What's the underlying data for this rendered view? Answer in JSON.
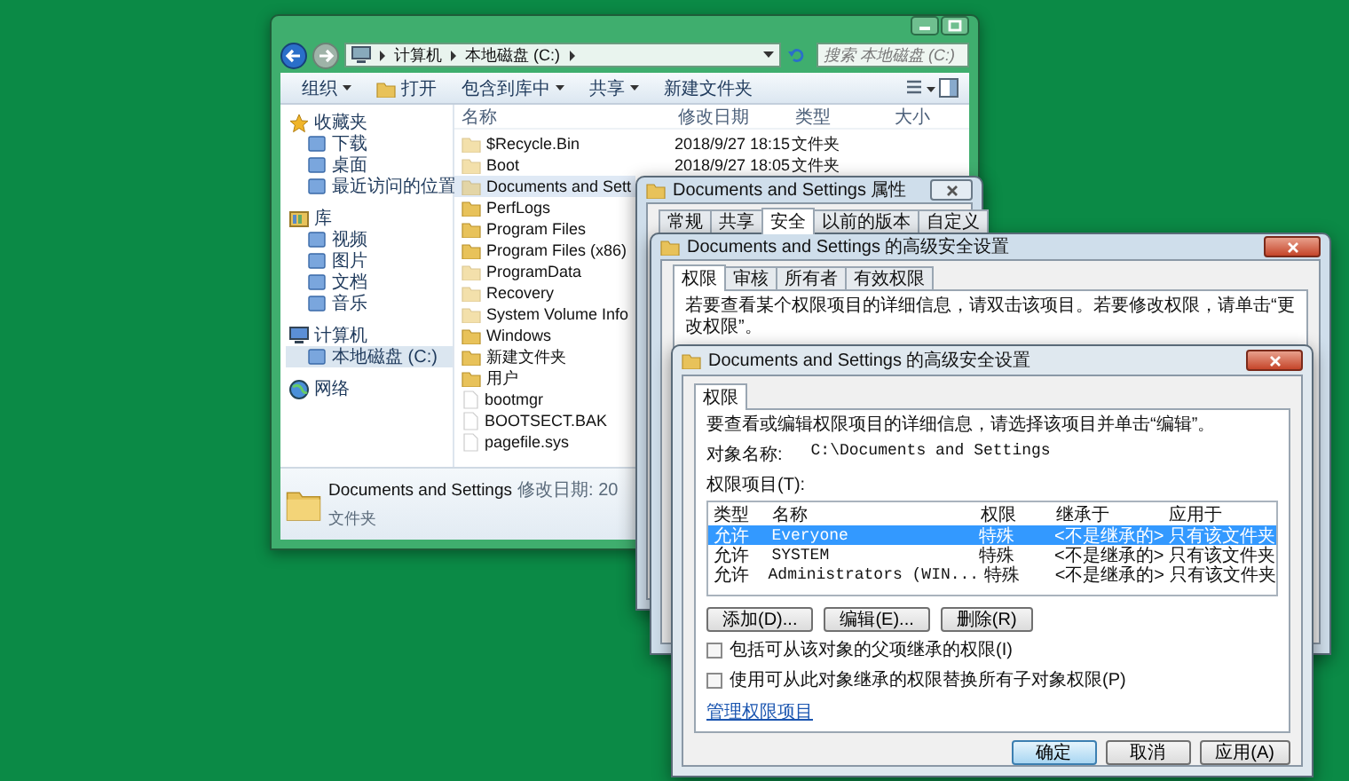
{
  "explorer": {
    "address": {
      "segments": [
        "计算机",
        "本地磁盘 (C:)"
      ]
    },
    "search": {
      "placeholder": "搜索 本地磁盘 (C:)"
    },
    "toolbar": [
      {
        "label": "组织",
        "dropdown": true,
        "has_icon": false
      },
      {
        "label": "打开",
        "dropdown": false,
        "has_icon": true
      },
      {
        "label": "包含到库中",
        "dropdown": true,
        "has_icon": false
      },
      {
        "label": "共享",
        "dropdown": true,
        "has_icon": false
      },
      {
        "label": "新建文件夹",
        "dropdown": false,
        "has_icon": false
      }
    ],
    "sidebar": [
      {
        "label": "收藏夹",
        "kind": "favorites",
        "selected": false,
        "children": [
          {
            "label": "下载",
            "selected": false
          },
          {
            "label": "桌面",
            "selected": false
          },
          {
            "label": "最近访问的位置",
            "selected": false
          }
        ]
      },
      {
        "label": "库",
        "kind": "libraries",
        "selected": false,
        "children": [
          {
            "label": "视频",
            "selected": false
          },
          {
            "label": "图片",
            "selected": false
          },
          {
            "label": "文档",
            "selected": false
          },
          {
            "label": "音乐",
            "selected": false
          }
        ]
      },
      {
        "label": "计算机",
        "kind": "computer",
        "selected": false,
        "children": [
          {
            "label": "本地磁盘 (C:)",
            "selected": true
          }
        ]
      },
      {
        "label": "网络",
        "kind": "network",
        "selected": false
      }
    ],
    "columns": [
      "名称",
      "修改日期",
      "类型",
      "大小"
    ],
    "rows": [
      {
        "name": "$Recycle.Bin",
        "date": "2018/9/27 18:15",
        "type": "文件夹",
        "kind": "folder",
        "hidden": true,
        "selected": false
      },
      {
        "name": "Boot",
        "date": "2018/9/27 18:05",
        "type": "文件夹",
        "kind": "folder",
        "hidden": true,
        "selected": false
      },
      {
        "name": "Documents and Sett",
        "kind": "folder",
        "hidden": true,
        "selected": true
      },
      {
        "name": "PerfLogs",
        "kind": "folder",
        "hidden": false,
        "selected": false
      },
      {
        "name": "Program Files",
        "kind": "folder",
        "hidden": false,
        "selected": false
      },
      {
        "name": "Program Files (x86)",
        "kind": "folder",
        "hidden": false,
        "selected": false
      },
      {
        "name": "ProgramData",
        "kind": "folder",
        "hidden": true,
        "selected": false
      },
      {
        "name": "Recovery",
        "kind": "folder",
        "hidden": true,
        "selected": false
      },
      {
        "name": "System Volume Info",
        "kind": "folder",
        "hidden": true,
        "selected": false
      },
      {
        "name": "Windows",
        "kind": "folder",
        "hidden": false,
        "selected": false
      },
      {
        "name": "新建文件夹",
        "kind": "folder",
        "hidden": false,
        "selected": false
      },
      {
        "name": "用户",
        "kind": "folder",
        "hidden": false,
        "selected": false
      },
      {
        "name": "bootmgr",
        "kind": "file",
        "hidden": true,
        "selected": false
      },
      {
        "name": "BOOTSECT.BAK",
        "kind": "file",
        "hidden": true,
        "selected": false
      },
      {
        "name": "pagefile.sys",
        "kind": "file",
        "hidden": true,
        "selected": false
      }
    ],
    "details": {
      "name": "Documents and Settings",
      "modified": "修改日期: 20",
      "type": "文件夹"
    }
  },
  "properties_dialog": {
    "title": "Documents and Settings 属性",
    "tabs": [
      {
        "label": "常规",
        "selected": false
      },
      {
        "label": "共享",
        "selected": false
      },
      {
        "label": "安全",
        "selected": true
      },
      {
        "label": "以前的版本",
        "selected": false
      },
      {
        "label": "自定义",
        "selected": false
      }
    ]
  },
  "advanced_dialog_back": {
    "title": "Documents and Settings 的高级安全设置",
    "tabs": [
      {
        "label": "权限",
        "selected": true
      },
      {
        "label": "审核",
        "selected": false
      },
      {
        "label": "所有者",
        "selected": false
      },
      {
        "label": "有效权限",
        "selected": false
      }
    ],
    "instruction": "若要查看某个权限项目的详细信息，请双击该项目。若要修改权限，请单击“更改权限”。"
  },
  "advanced_dialog_front": {
    "title": "Documents and Settings 的高级安全设置",
    "tabs": [
      {
        "label": "权限",
        "selected": true
      }
    ],
    "instruction": "要查看或编辑权限项目的详细信息，请选择该项目并单击“编辑”。",
    "object_label": "对象名称:",
    "object_value": "C:\\Documents and Settings",
    "entries_label": "权限项目(T):",
    "table": {
      "columns": [
        "类型",
        "名称",
        "权限",
        "继承于",
        "应用于"
      ],
      "rows": [
        {
          "cells": [
            "允许",
            "Everyone",
            "特殊",
            "<不是继承的>",
            "只有该文件夹"
          ],
          "selected": true
        },
        {
          "cells": [
            "允许",
            "SYSTEM",
            "特殊",
            "<不是继承的>",
            "只有该文件夹"
          ],
          "selected": false
        },
        {
          "cells": [
            "允许",
            "Administrators (WIN...",
            "特殊",
            "<不是继承的>",
            "只有该文件夹"
          ],
          "selected": false
        }
      ]
    },
    "buttons": [
      "添加(D)...",
      "编辑(E)...",
      "删除(R)"
    ],
    "checkboxes": [
      {
        "label": "包括可从该对象的父项继承的权限(I)",
        "checked": false
      },
      {
        "label": "使用可从此对象继承的权限替换所有子对象权限(P)",
        "checked": false
      }
    ],
    "link": "管理权限项目",
    "footer_buttons": [
      {
        "label": "确定",
        "default": true
      },
      {
        "label": "取消",
        "default": false
      },
      {
        "label": "应用(A)",
        "default": false
      }
    ]
  }
}
